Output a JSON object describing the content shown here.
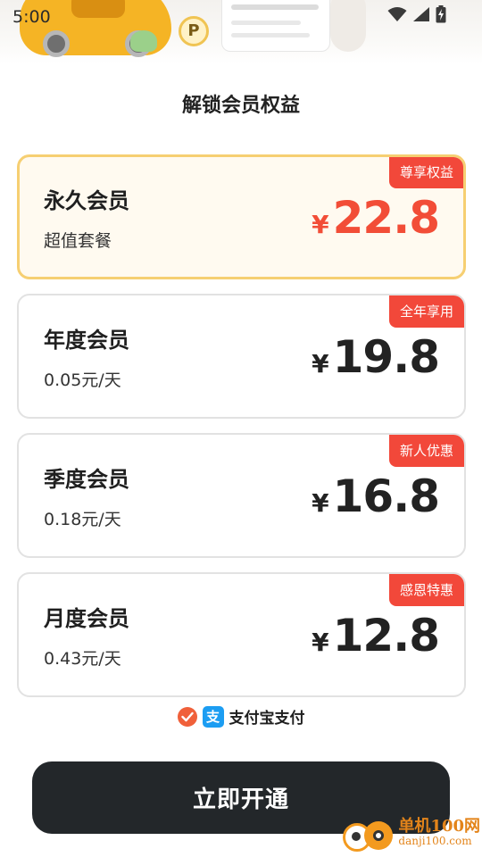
{
  "status_bar": {
    "time": "5:00",
    "icons": [
      "wifi-icon",
      "cellular-signal-icon",
      "battery-charging-icon"
    ]
  },
  "banner": {
    "sign_text": "P"
  },
  "page": {
    "title": "解锁会员权益"
  },
  "plans": [
    {
      "name": "永久会员",
      "sub": "超值套餐",
      "currency": "¥",
      "price": "22.8",
      "badge": "尊享权益",
      "selected": true
    },
    {
      "name": "年度会员",
      "sub": "0.05元/天",
      "currency": "¥",
      "price": "19.8",
      "badge": "全年享用",
      "selected": false
    },
    {
      "name": "季度会员",
      "sub": "0.18元/天",
      "currency": "¥",
      "price": "16.8",
      "badge": "新人优惠",
      "selected": false
    },
    {
      "name": "月度会员",
      "sub": "0.43元/天",
      "currency": "¥",
      "price": "12.8",
      "badge": "感恩特惠",
      "selected": false
    }
  ],
  "payment": {
    "method_label": "支付宝支付",
    "alipay_glyph": "支",
    "checked": true
  },
  "cta": {
    "label": "立即开通"
  },
  "watermark": {
    "main": "单机100网",
    "sub": "danji100.com"
  },
  "colors": {
    "accent_price": "#f24d37",
    "badge": "#f2483a",
    "selected_border": "#f6cf72",
    "cta_bg": "#23272a",
    "alipay_blue": "#1c9df2"
  }
}
